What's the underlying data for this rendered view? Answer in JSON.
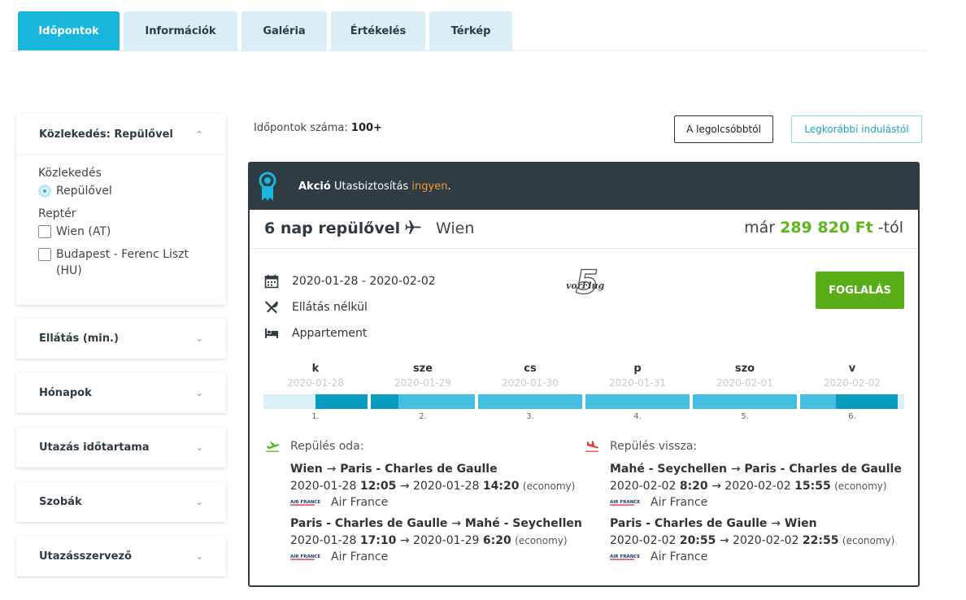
{
  "tabs": [
    "Időpontok",
    "Információk",
    "Galéria",
    "Értékelés",
    "Térkép"
  ],
  "sidebar": {
    "transport": {
      "title": "Közlekedés: Repülővel",
      "group1_label": "Közlekedés",
      "radio_option": "Repülővel",
      "group2_label": "Reptér",
      "airports": [
        "Wien (AT)",
        "Budapest - Ferenc Liszt (HU)"
      ]
    },
    "filters": [
      "Ellátás (min.)",
      "Hónapok",
      "Utazás időtartama",
      "Szobák",
      "Utazásszervező"
    ]
  },
  "results": {
    "count_label": "Időpontok száma:",
    "count_value": "100+",
    "sort_cheapest": "A legolcsóbbtól",
    "sort_earliest": "Legkorábbi indulástól"
  },
  "card": {
    "promo_bold": "Akció",
    "promo_text": "Utasbiztosítás",
    "promo_highlight": "ingyen",
    "promo_end": ".",
    "title": "6 nap repülővel",
    "destination": "Wien",
    "price_prefix": "már",
    "price_value": "289 820 Ft",
    "price_suffix": "-tól",
    "dates": "2020-01-28 - 2020-02-02",
    "board": "Ellátás nélkül",
    "room": "Appartement",
    "operator_logo_text": "vorFlug",
    "operator_logo_number": "5",
    "book_label": "FOGLALÁS",
    "days": [
      {
        "day": "k",
        "date": "2020-01-28",
        "num": "1."
      },
      {
        "day": "sze",
        "date": "2020-01-29",
        "num": "2."
      },
      {
        "day": "cs",
        "date": "2020-01-30",
        "num": "3."
      },
      {
        "day": "p",
        "date": "2020-01-31",
        "num": "4."
      },
      {
        "day": "szo",
        "date": "2020-02-01",
        "num": "5."
      },
      {
        "day": "v",
        "date": "2020-02-02",
        "num": "6."
      }
    ],
    "outbound": {
      "label": "Repülés oda:",
      "legs": [
        {
          "from": "Wien",
          "to": "Paris - Charles de Gaulle",
          "dep_date": "2020-01-28",
          "dep_time": "12:05",
          "arr_date": "2020-01-28",
          "arr_time": "14:20",
          "class": "(economy)",
          "airline": "Air France"
        },
        {
          "from": "Paris - Charles de Gaulle",
          "to": "Mahé - Seychellen",
          "dep_date": "2020-01-28",
          "dep_time": "17:10",
          "arr_date": "2020-01-29",
          "arr_time": "6:20",
          "class": "(economy)",
          "airline": "Air France"
        }
      ]
    },
    "inbound": {
      "label": "Repülés vissza:",
      "legs": [
        {
          "from": "Mahé - Seychellen",
          "to": "Paris - Charles de Gaulle",
          "dep_date": "2020-02-02",
          "dep_time": "8:20",
          "arr_date": "2020-02-02",
          "arr_time": "15:55",
          "class": "(economy)",
          "airline": "Air France"
        },
        {
          "from": "Paris - Charles de Gaulle",
          "to": "Wien",
          "dep_date": "2020-02-02",
          "dep_time": "20:55",
          "arr_date": "2020-02-02",
          "arr_time": "22:55",
          "class": "(economy)",
          "airline": "Air France"
        }
      ]
    },
    "airline_logo_text": "AIR FRANCE",
    "arrow": "→"
  },
  "colors": {
    "accent": "#18b6dc",
    "tab_inactive": "#dbeef8",
    "promo_bg": "#2f3c43",
    "price_green": "#5bb71c",
    "book_green": "#59ad16",
    "highlight_orange": "#f39a2b",
    "bar_light": "#daf0f8",
    "bar_mid": "#45bfdf",
    "bar_dark": "#0a9cbf"
  }
}
